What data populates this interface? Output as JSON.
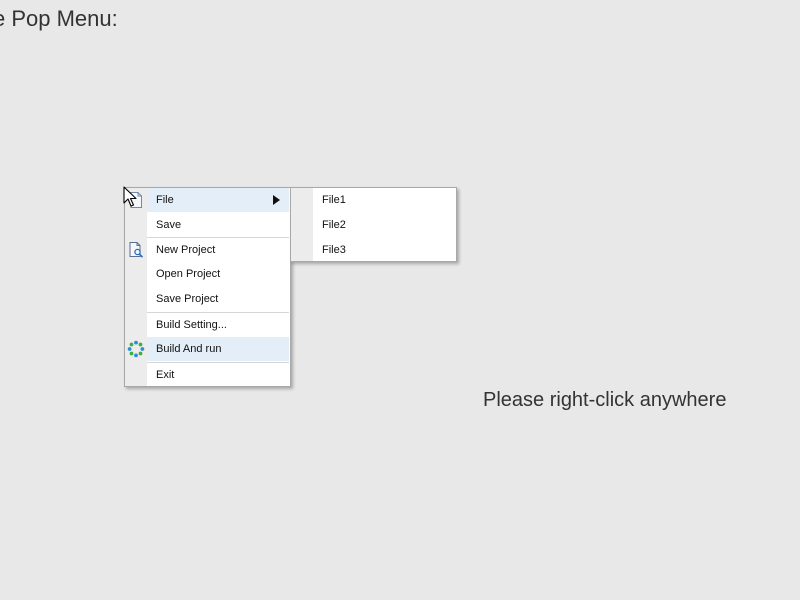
{
  "page": {
    "title": "se Pop Menu:"
  },
  "hint": "Please right-click anywhere",
  "context_menu": {
    "items": [
      {
        "label": "File",
        "icon": "document-icon",
        "has_submenu": true,
        "highlighted": true
      },
      {
        "label": "Save"
      },
      {
        "label": "New Project",
        "icon": "new-project-icon"
      },
      {
        "label": "Open Project"
      },
      {
        "label": "Save Project"
      },
      {
        "label": "Build Setting..."
      },
      {
        "label": "Build And run",
        "icon": "build-run-icon",
        "highlighted": true
      },
      {
        "label": "Exit"
      }
    ]
  },
  "submenu": {
    "items": [
      {
        "label": "File1"
      },
      {
        "label": "File2"
      },
      {
        "label": "File3"
      }
    ]
  },
  "colors": {
    "background": "#e8e8e8",
    "highlight": "#e3eef8",
    "gutter": "#ececec"
  }
}
